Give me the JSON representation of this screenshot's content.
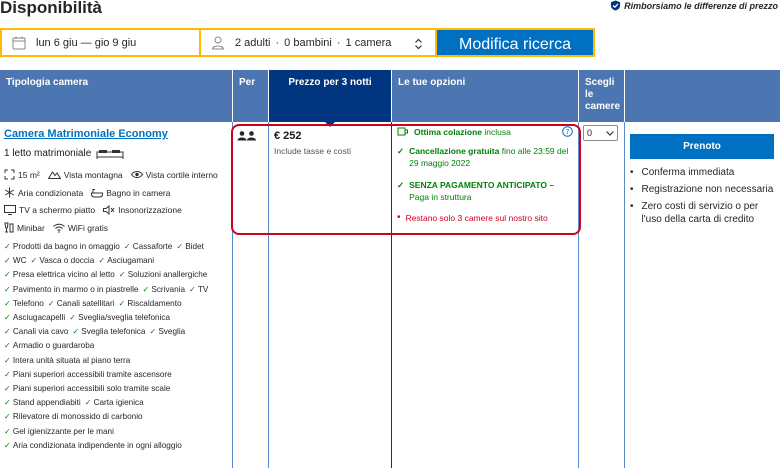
{
  "title": "Disponibilità",
  "price_promise": "Rimborsiamo le differenze di prezzo",
  "search": {
    "dates": "lun 6 giu — gio 9 giu",
    "guests": [
      "2 adulti",
      "·",
      "0 bambini",
      "·",
      "1 camera"
    ],
    "submit": "Modifica ricerca"
  },
  "headers": {
    "room_type": "Tipologia camera",
    "per": "Per",
    "price": "Prezzo per 3 notti",
    "options": "Le tue opzioni",
    "select": "Scegli le camere"
  },
  "room": {
    "name": "Camera Matrimoniale Economy",
    "bed": "1 letto matrimoniale",
    "facilities": [
      [
        {
          "icon": "area-icon",
          "label": "15 m²"
        },
        {
          "icon": "mountain-icon",
          "label": "Vista montagna"
        },
        {
          "icon": "eye-icon",
          "label": "Vista cortile interno"
        }
      ],
      [
        {
          "icon": "snowflake-icon",
          "label": "Aria condizionata"
        },
        {
          "icon": "bath-icon",
          "label": "Bagno in camera"
        }
      ],
      [
        {
          "icon": "tv-icon",
          "label": "TV a schermo piatto"
        },
        {
          "icon": "soundproof-icon",
          "label": "Insonorizzazione"
        }
      ],
      [
        {
          "icon": "minibar-icon",
          "label": "Minibar"
        },
        {
          "icon": "wifi-icon",
          "label": "WiFi gratis"
        }
      ]
    ],
    "amenities": [
      [
        "Prodotti da bagno in omaggio",
        "Cassaforte",
        "Bidet"
      ],
      [
        "WC",
        "Vasca o doccia",
        "Asciugamani"
      ],
      [
        "Presa elettrica vicino al letto",
        "Soluzioni anallergiche"
      ],
      [
        "Pavimento in marmo o in piastrelle",
        "Scrivania",
        "TV"
      ],
      [
        "Telefono",
        "Canali satellitari",
        "Riscaldamento"
      ],
      [
        "Asciugacapelli",
        "Sveglia/sveglia telefonica"
      ],
      [
        "Canali via cavo",
        "Sveglia telefonica",
        "Sveglia"
      ],
      [
        "Armadio o guardaroba"
      ],
      [
        "Intera unità situata al piano terra"
      ],
      [
        "Piani superiori accessibili tramite ascensore"
      ],
      [
        "Piani superiori accessibili solo tramite scale"
      ],
      [
        "Stand appendiabiti",
        "Carta igienica"
      ],
      [
        "Rilevatore di monossido di carbonio"
      ],
      [
        "Gel igienizzante per le mani"
      ],
      [
        "Aria condizionata indipendente in ogni alloggio"
      ]
    ]
  },
  "price": {
    "amount": "€ 252",
    "note": "Include tasse e costi"
  },
  "options": {
    "breakfast_bold": "Ottima colazione",
    "breakfast_rest": "inclusa",
    "cancel_bold": "Cancellazione gratuita",
    "cancel_rest": "fino alle 23:59 del 29 maggio 2022",
    "nopay_bold": "SENZA PAGAMENTO ANTICIPATO –",
    "nopay_rest": "Paga in struttura",
    "scarcity": "Restano solo 3 camere sul nostro sito"
  },
  "select_value": "0",
  "book_button": "Prenoto",
  "benefits": [
    "Conferma immediata",
    "Registrazione non necessaria",
    "Zero costi di servizio o per l'uso della carta di credito"
  ],
  "colors": {
    "header_blue": "#4c76b2",
    "dark_blue": "#003580",
    "action_blue": "#0071c2",
    "yellow": "#febb02",
    "green": "#008009",
    "red": "#d0021b"
  }
}
